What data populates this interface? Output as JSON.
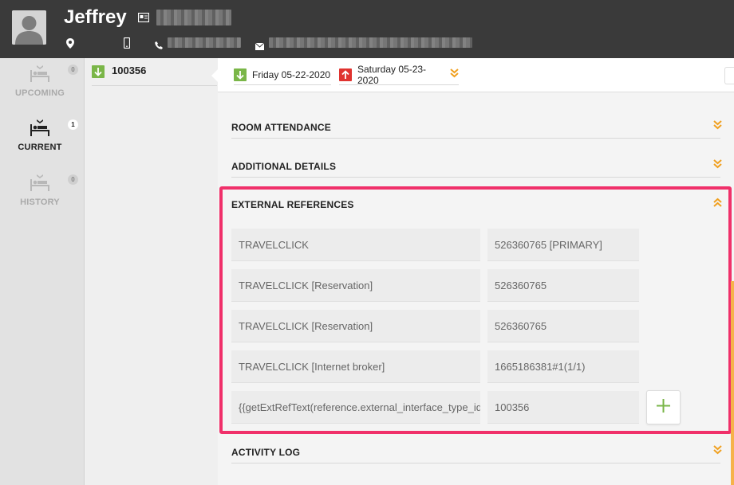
{
  "header": {
    "guest_name": "Jeffrey",
    "icons": [
      "avatar",
      "id-card-icon",
      "location-pin-icon",
      "mobile-phone-icon",
      "phone-icon",
      "envelope-icon"
    ],
    "background": "#3a3a3a"
  },
  "leftnav": {
    "items": [
      {
        "label": "UPCOMING",
        "badge": "0",
        "active": false,
        "icon": "bed-arrow-icon"
      },
      {
        "label": "CURRENT",
        "badge": "1",
        "active": true,
        "icon": "bed-arrow-icon"
      },
      {
        "label": "HISTORY",
        "badge": "0",
        "active": false,
        "icon": "bed-arrow-icon"
      }
    ]
  },
  "reservations": {
    "items": [
      {
        "number": "100356",
        "icon": "arrow-down-green-icon"
      }
    ]
  },
  "datebar": {
    "arrival": "Friday 05-22-2020",
    "departure": "Saturday 05-23-2020"
  },
  "sections": {
    "room_attendance": "ROOM ATTENDANCE",
    "additional_details": "ADDITIONAL DETAILS",
    "external_references": "EXTERNAL REFERENCES",
    "activity_log": "ACTIVITY LOG"
  },
  "external_references": {
    "rows": [
      {
        "type": "TRAVELCLICK",
        "value": "526360765 [PRIMARY]"
      },
      {
        "type": "TRAVELCLICK [Reservation]",
        "value": "526360765"
      },
      {
        "type": "TRAVELCLICK [Reservation]",
        "value": "526360765"
      },
      {
        "type": "TRAVELCLICK [Internet broker]",
        "value": "1665186381#1(1/1)"
      }
    ],
    "new_row": {
      "type": "{{getExtRefText(reference.external_interface_type_id",
      "value": "100356"
    },
    "add_button_icon": "plus-icon"
  },
  "colors": {
    "highlight_border": "#f0306a",
    "chevron": "#f0a020",
    "arrival_green": "#7ab648",
    "departure_red": "#e0332f"
  }
}
